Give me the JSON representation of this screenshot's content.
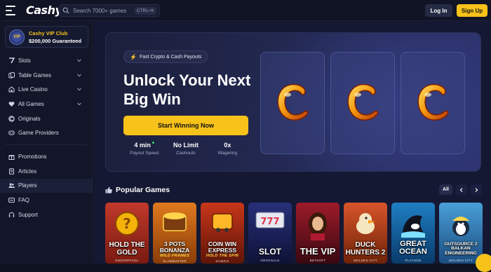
{
  "header": {
    "logo": "Cashy",
    "search_placeholder": "Search 7000+ games",
    "search_shortcut": "CTRL+K",
    "login_label": "Log In",
    "signup_label": "Sign Up"
  },
  "sidebar": {
    "vip": {
      "title": "Cashy VIP Club",
      "subtitle": "$200,000 Guaranteed",
      "badge": "VIP"
    },
    "items": [
      {
        "label": "Slots",
        "icon": "slot-seven-icon",
        "chevron": true
      },
      {
        "label": "Table Games",
        "icon": "cards-icon",
        "chevron": true
      },
      {
        "label": "Live Casino",
        "icon": "live-casino-icon",
        "chevron": true
      },
      {
        "label": "All Games",
        "icon": "heart-icon",
        "chevron": true
      },
      {
        "label": "Originals",
        "icon": "originals-icon",
        "chevron": false
      },
      {
        "label": "Game Providers",
        "icon": "providers-icon",
        "chevron": false
      }
    ],
    "items2": [
      {
        "label": "Promotions",
        "icon": "gift-icon"
      },
      {
        "label": "Articles",
        "icon": "document-icon"
      },
      {
        "label": "Players",
        "icon": "users-icon"
      },
      {
        "label": "FAQ",
        "icon": "faq-icon"
      },
      {
        "label": "Support",
        "icon": "headset-icon"
      }
    ]
  },
  "hero": {
    "pill": "Fast Crypto & Cash Payouts",
    "headline": "Unlock Your Next Big Win",
    "cta": "Start Winning Now",
    "stats": [
      {
        "value": "4 min",
        "label": "Payout Speed"
      },
      {
        "value": "No Limit",
        "label": "Cashouts"
      },
      {
        "value": "0x",
        "label": "Wagering"
      }
    ]
  },
  "popular": {
    "title": "Popular Games",
    "all_label": "All",
    "games": [
      {
        "title": "HOLD THE GOLD",
        "studio": "ENDORPHINA",
        "bg1": "#c0392b",
        "bg2": "#7a1a10",
        "accent": "#f5b30a"
      },
      {
        "title": "3 POTS BONANZA",
        "sub": "WILD FRAMES",
        "studio": "SLAMBUSTER",
        "bg1": "#e07a1f",
        "bg2": "#8a3c08",
        "accent": "#ffd34a"
      },
      {
        "title": "COIN WIN EXPRESS",
        "sub": "HOLD THE SPIN",
        "studio": "GAMZIX",
        "bg1": "#c8361a",
        "bg2": "#5e1508",
        "accent": "#ffb728"
      },
      {
        "title": "SLOT",
        "studio": "ORIGINALS",
        "bg1": "#27307a",
        "bg2": "#0e1236",
        "accent": "#e0334a"
      },
      {
        "title": "THE VIP",
        "studio": "BETSOFT",
        "bg1": "#9e1b2a",
        "bg2": "#3a0810",
        "accent": "#f0c050"
      },
      {
        "title": "DUCK HUNTERS 2",
        "studio": "MOLDEN CITY",
        "bg1": "#d8552a",
        "bg2": "#6e2208",
        "accent": "#ffce3a"
      },
      {
        "title": "GREAT OCEAN",
        "studio": "PLAYSON",
        "bg1": "#1f7fc4",
        "bg2": "#0a3a6a",
        "accent": "#7fe0ff"
      },
      {
        "title": "OUTSOURCE 2 BALKAN ENGINEERING",
        "studio": "MOLDEN CITY",
        "bg1": "#4a9fd8",
        "bg2": "#1a4d80",
        "accent": "#ffd54a"
      }
    ]
  },
  "colors": {
    "accent": "#f7c21a",
    "background": "#0f1220",
    "panel": "#141833"
  }
}
